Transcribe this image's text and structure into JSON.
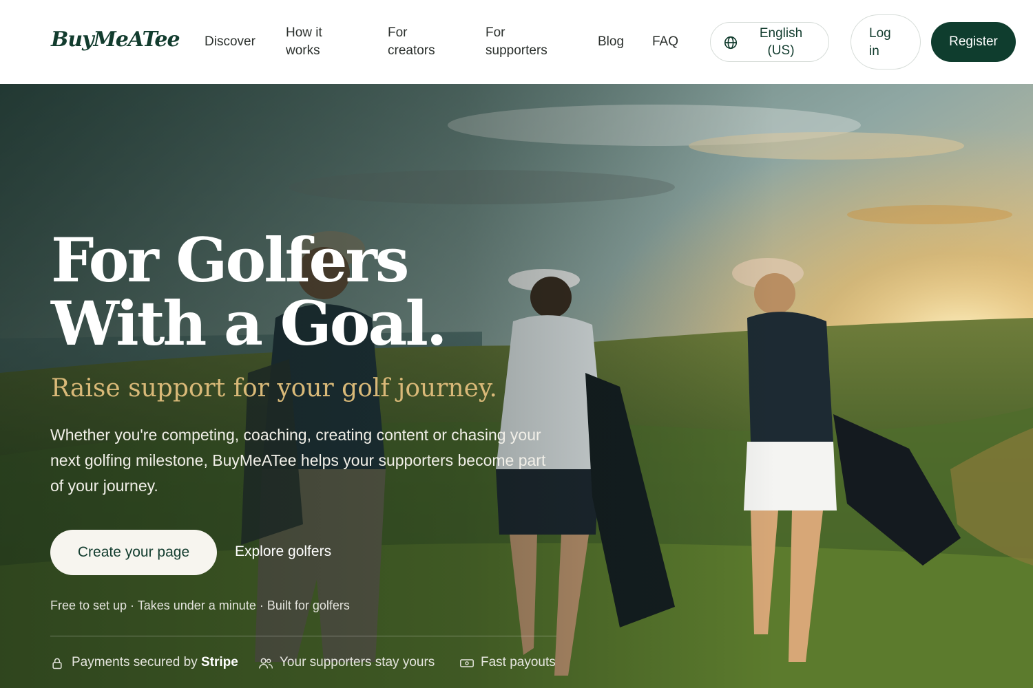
{
  "brand": {
    "logo": "BuyMeATee"
  },
  "nav": {
    "links": [
      "Discover",
      "How it works",
      "For creators",
      "For supporters",
      "Blog",
      "FAQ"
    ],
    "language": "English (US)",
    "login": "Log in",
    "register": "Register"
  },
  "hero": {
    "headline_line1": "For Golfers",
    "headline_line2": "With a Goal.",
    "subheadline": "Raise support for your golf journey.",
    "description": "Whether you're competing, coaching, creating content or chasing your next golfing milestone, BuyMeATee helps your supporters become part of your journey.",
    "cta_primary": "Create your page",
    "cta_secondary": "Explore golfers",
    "note": "Free to set up · Takes under a minute · Built for golfers"
  },
  "trust": {
    "payments_prefix": "Payments secured by ",
    "payments_brand": "Stripe",
    "supporters": "Your supporters stay yours",
    "payouts": "Fast payouts"
  },
  "colors": {
    "brand_green": "#0f3d2e",
    "gold": "#d9b978",
    "cream": "#f7f5ef"
  },
  "icons": [
    "globe-icon",
    "lock-icon",
    "users-icon",
    "cash-icon"
  ]
}
